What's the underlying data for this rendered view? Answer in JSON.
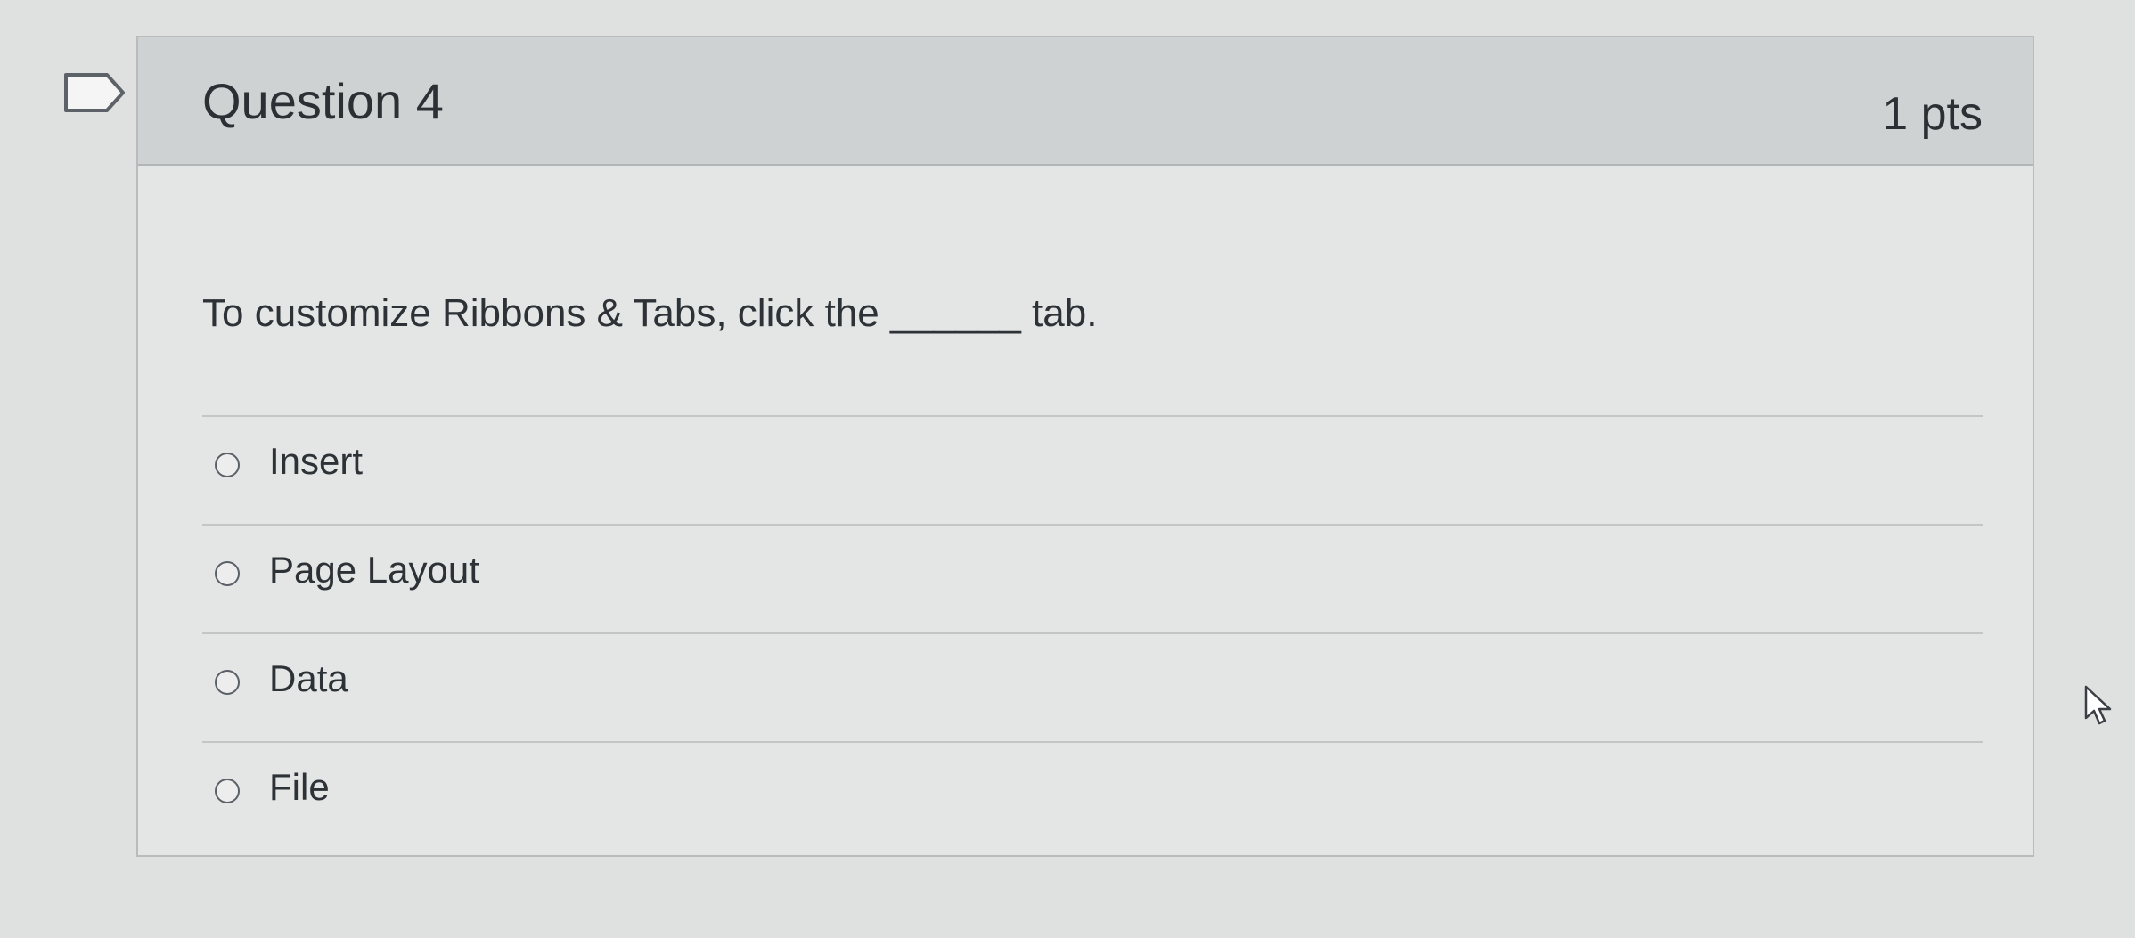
{
  "question": {
    "title": "Question 4",
    "points": "1 pts",
    "text": "To customize Ribbons & Tabs, click the ______ tab.",
    "answers": [
      {
        "label": "Insert"
      },
      {
        "label": "Page Layout"
      },
      {
        "label": "Data"
      },
      {
        "label": "File"
      }
    ]
  },
  "icons": {
    "flag": "flag-question-icon",
    "cursor": "mouse-pointer-icon",
    "radio": "radio-button-icon"
  },
  "colors": {
    "page_background": "#dfe1e0",
    "header_background": "#cfd2d2",
    "body_background": "#e4e6e5",
    "border": "#b9bcbd",
    "text": "#2d3237"
  }
}
